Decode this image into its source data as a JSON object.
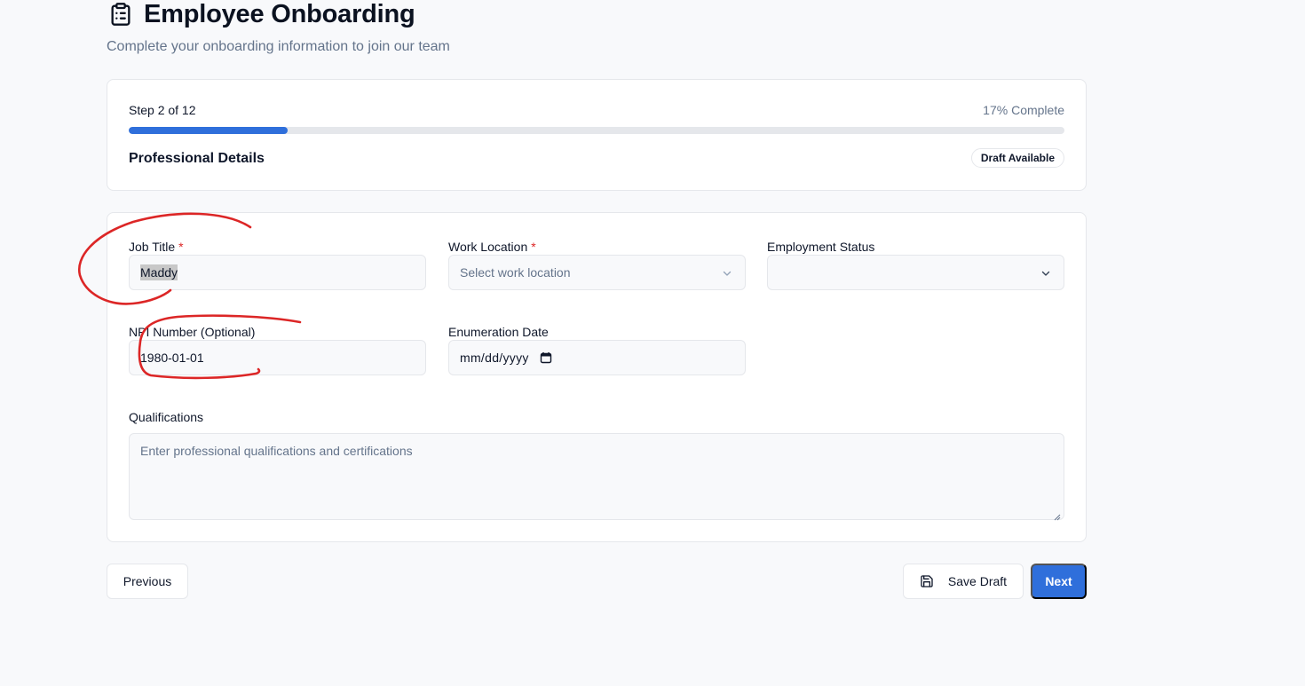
{
  "header": {
    "title": "Employee Onboarding",
    "subtitle": "Complete your onboarding information to join our team",
    "icon": "clipboard-list-icon"
  },
  "progress": {
    "step_label": "Step 2 of 12",
    "percent_label": "17% Complete",
    "fraction_complete": 0.17,
    "section_title": "Professional Details",
    "badge": "Draft Available"
  },
  "form": {
    "job_title": {
      "label": "Job Title",
      "required_mark": "*",
      "value": "Maddy"
    },
    "work_location": {
      "label": "Work Location",
      "required_mark": "*",
      "placeholder": "Select work location"
    },
    "employment_status": {
      "label": "Employment Status",
      "value": ""
    },
    "npi_number": {
      "label": "NPI Number (Optional)",
      "value": "1980-01-01"
    },
    "enumeration_date": {
      "label": "Enumeration Date",
      "placeholder": "mm/dd/yyyy"
    },
    "qualifications": {
      "label": "Qualifications",
      "placeholder": "Enter professional qualifications and certifications"
    }
  },
  "actions": {
    "previous": "Previous",
    "save_draft": "Save Draft",
    "next": "Next"
  },
  "colors": {
    "accent": "#2f6fdb",
    "required": "#dc2626",
    "annotation": "#dc2626"
  }
}
